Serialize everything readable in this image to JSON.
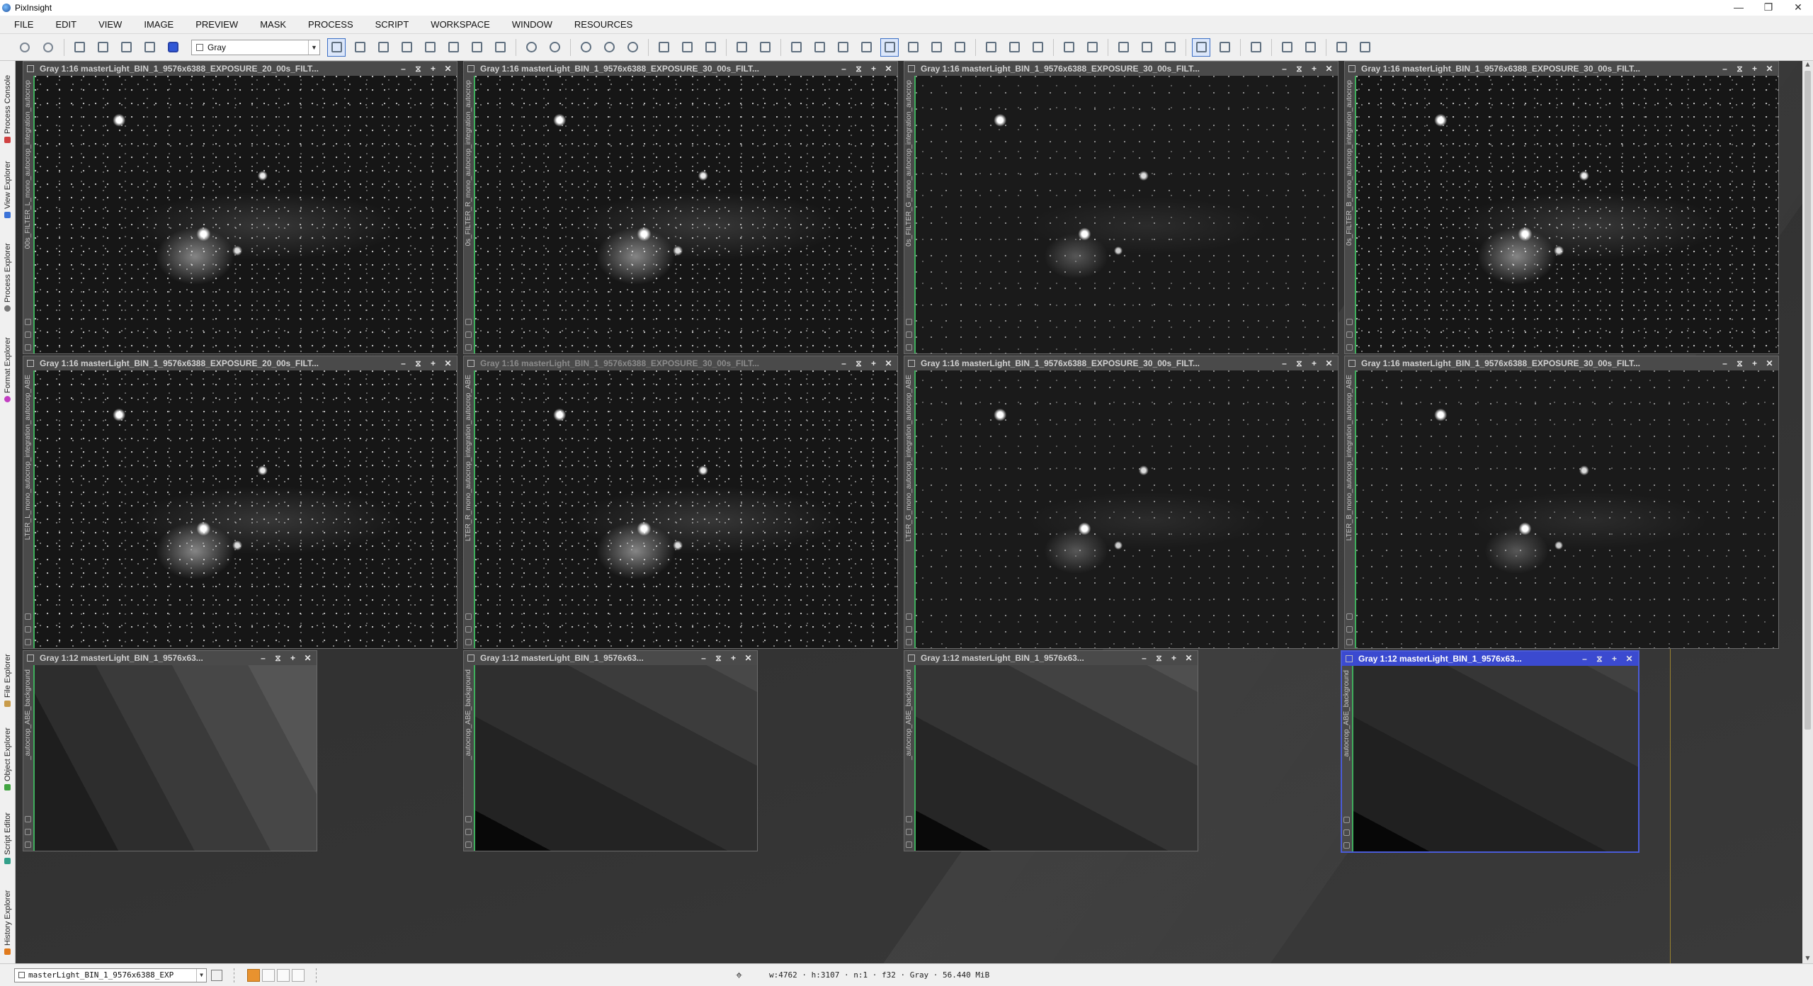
{
  "app": {
    "title": "PixInsight",
    "window_controls": [
      "—",
      "❐",
      "✕"
    ]
  },
  "menu": [
    "FILE",
    "EDIT",
    "VIEW",
    "IMAGE",
    "PREVIEW",
    "MASK",
    "PROCESS",
    "SCRIPT",
    "WORKSPACE",
    "WINDOW",
    "RESOURCES"
  ],
  "toolbar": {
    "color_space": "Gray"
  },
  "side_panel": [
    "Process Console",
    "View Explorer",
    "Process Explorer",
    "Format Explorer",
    "File Explorer",
    "Object Explorer",
    "Script Editor",
    "History Explorer"
  ],
  "windows": {
    "row1": [
      {
        "title": "Gray 1:16 masterLight_BIN_1_9576x6388_EXPOSURE_20_00s_FILT...",
        "side": "00s_FILTER_L_mono_autocrop_integration_autocrop"
      },
      {
        "title": "Gray 1:16 masterLight_BIN_1_9576x6388_EXPOSURE_30_00s_FILT...",
        "side": "0s_FILTER_R_mono_autocrop_integration_autocrop"
      },
      {
        "title": "Gray 1:16 masterLight_BIN_1_9576x6388_EXPOSURE_30_00s_FILT...",
        "side": "0s_FILTER_G_mono_autocrop_integration_autocrop"
      },
      {
        "title": "Gray 1:16 masterLight_BIN_1_9576x6388_EXPOSURE_30_00s_FILT...",
        "side": "0s_FILTER_B_mono_autocrop_integration_autocrop"
      }
    ],
    "row2": [
      {
        "title": "Gray 1:16 masterLight_BIN_1_9576x6388_EXPOSURE_20_00s_FILT...",
        "side": "LTER_L_mono_autocrop_integration_autocrop_ABE"
      },
      {
        "title": "Gray 1:16 masterLight_BIN_1_9576x6388_EXPOSURE_30_00s_FILT...",
        "side": "LTER_R_mono_autocrop_integration_autocrop_ABE"
      },
      {
        "title": "Gray 1:16 masterLight_BIN_1_9576x6388_EXPOSURE_30_00s_FILT...",
        "side": "LTER_G_mono_autocrop_integration_autocrop_ABE"
      },
      {
        "title": "Gray 1:16 masterLight_BIN_1_9576x6388_EXPOSURE_30_00s_FILT...",
        "side": "LTER_B_mono_autocrop_integration_autocrop_ABE"
      }
    ],
    "row3": [
      {
        "title": "Gray 1:12 masterLight_BIN_1_9576x63...",
        "side": "_autocrop_ABE_background"
      },
      {
        "title": "Gray 1:12 masterLight_BIN_1_9576x63...",
        "side": "_autocrop_ABE_background"
      },
      {
        "title": "Gray 1:12 masterLight_BIN_1_9576x63...",
        "side": "_autocrop_ABE_background"
      },
      {
        "title": "Gray 1:12 masterLight_BIN_1_9576x63...",
        "side": "_autocrop_ABE_background"
      }
    ],
    "title_buttons": [
      "–",
      "⧖",
      "+",
      "✕"
    ]
  },
  "statusbar": {
    "view": "masterLight_BIN_1_9576x6388_EXP",
    "info": "w:4762 · h:3107 · n:1 · f32 · Gray · 56.440 MiB"
  },
  "colors": {
    "focused_window": "#3b4ad0",
    "tab_green": "#3fae5c",
    "accent_swatch": "#e8922f"
  }
}
